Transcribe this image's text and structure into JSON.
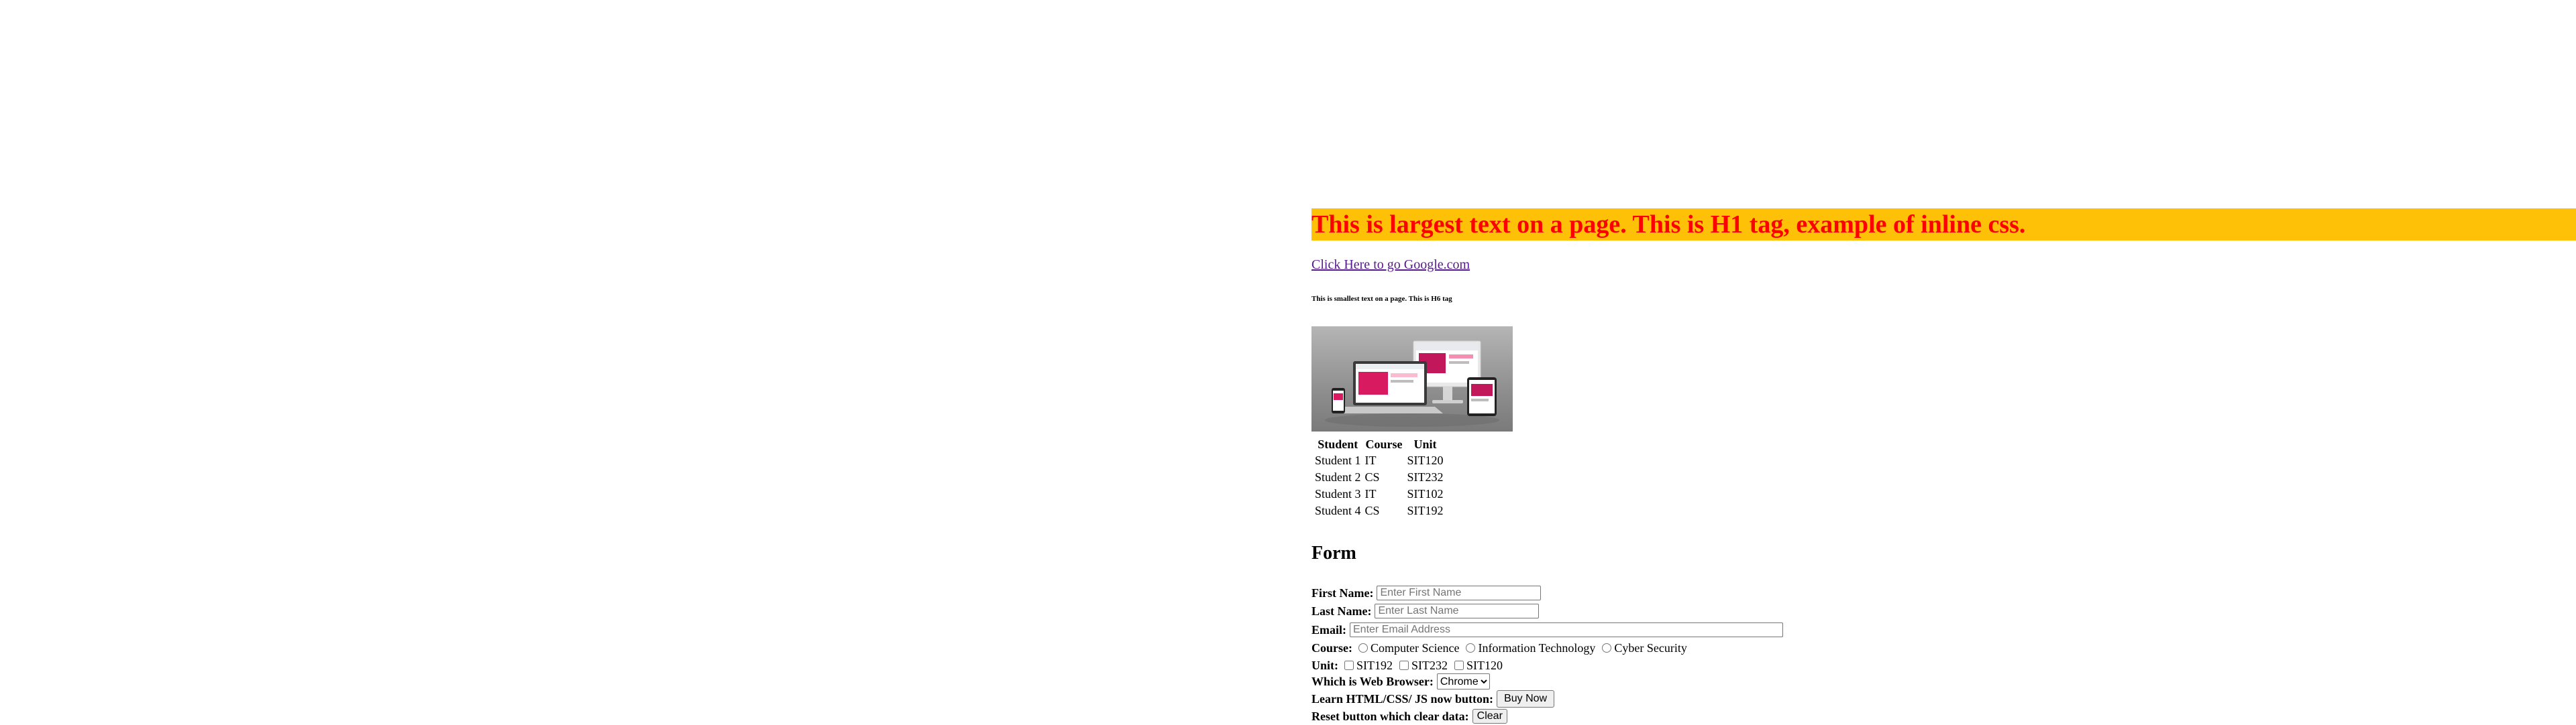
{
  "header": {
    "h1_text": "This is largest text on a page. This is H1 tag, example of inline css.",
    "link_text": "Click Here to go Google.com",
    "h6_text": "This is smallest text on a page. This is H6 tag"
  },
  "table": {
    "headers": [
      "Student",
      "Course",
      "Unit"
    ],
    "rows": [
      [
        "Student 1",
        "IT",
        "SIT120"
      ],
      [
        "Student 2",
        "CS",
        "SIT232"
      ],
      [
        "Student 3",
        "IT",
        "SIT102"
      ],
      [
        "Student 4",
        "CS",
        "SIT192"
      ]
    ]
  },
  "form": {
    "title": "Form",
    "first_name_label": "First Name:",
    "first_name_placeholder": "Enter First Name",
    "last_name_label": "Last Name:",
    "last_name_placeholder": "Enter Last Name",
    "email_label": "Email:",
    "email_placeholder": "Enter Email Address",
    "course_label": "Course:",
    "course_options": [
      "Computer Science",
      "Information Technology",
      "Cyber Security"
    ],
    "unit_label": "Unit:",
    "unit_options": [
      "SIT192",
      "SIT232",
      "SIT120"
    ],
    "browser_label": "Which is Web Browser:",
    "browser_selected": "Chrome",
    "buy_label": "Learn HTML/CSS/ JS now button:",
    "buy_button": "Buy Now",
    "reset_label": "Reset button which clear data:",
    "reset_button": "Clear"
  },
  "colors": {
    "h1_background": "#ffc107",
    "h1_text": "#ff0000",
    "link": "#551a8b"
  }
}
